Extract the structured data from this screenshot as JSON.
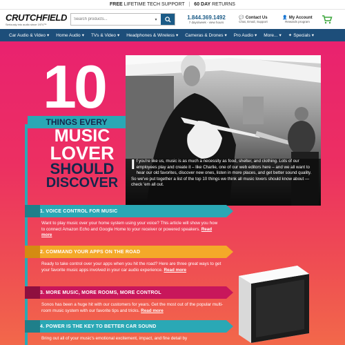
{
  "topbar": {
    "free": "FREE",
    "support": "LIFETIME TECH SUPPORT",
    "days": "60 DAY",
    "returns": "RETURNS"
  },
  "header": {
    "logo": "CRUTCHFIELD",
    "tagline": "Seriously into audio since 1974™",
    "search_placeholder": "Search products...",
    "phone": "1.844.369.1492",
    "phone_sub": "7 days/week - view hours",
    "contact_title": "Contact Us",
    "contact_sub": "Chat, Email, Support",
    "account_title": "My Account",
    "account_sub": "Rewards program"
  },
  "nav": [
    "Car Audio & Video",
    "Home Audio",
    "TVs & Video",
    "Headphones & Wireless",
    "Cameras & Drones",
    "Pro Audio",
    "More...",
    "Specials"
  ],
  "hero": {
    "number": "10",
    "things": "THINGS EVERY",
    "line1": "MUSIC",
    "line2": "LOVER",
    "line3": "SHOULD",
    "line4": "DISCOVER",
    "intro_cap": "I",
    "intro": "f you're like us, music is as much a necessity as food, shelter, and clothing. Lots of our employees play and create it – like Charlie, one of our web editors here – and we all want to hear our old favorites, discover new ones, listen in more places, and get better sound quality. So we've put together a list of the top 10 things we think all music lovers should know about — check 'em all out."
  },
  "sections": [
    {
      "title": "1. VOICE CONTROL FOR MUSIC",
      "text": "Want to play music over your home system using your voice? This article will show you how to connect Amazon Echo and Google Home to your receiver or powered speakers.",
      "link": "Read more",
      "color": "#2aa8b5"
    },
    {
      "title": "2. COMMAND YOUR APPS ON THE ROAD",
      "text": "Ready to take control over your apps when you hit the road? Here are three great ways to get your favorite music apps involved in your car audio experience.",
      "link": "Read more",
      "color": "#f4a929"
    },
    {
      "title": "3. MORE MUSIC, MORE ROOMS, MORE CONTROL",
      "text": "Sonos has been a huge hit with our customers for years. Get the most out of the popular multi-room music system with our favorite tips and tricks.",
      "link": "Read more",
      "color": "#c8175b"
    },
    {
      "title": "4. POWER IS THE KEY TO BETTER CAR SOUND",
      "text": "Bring out all of your music's emotional excitement, impact, and fine detail by",
      "link": "",
      "color": "#2aa8b5"
    }
  ]
}
